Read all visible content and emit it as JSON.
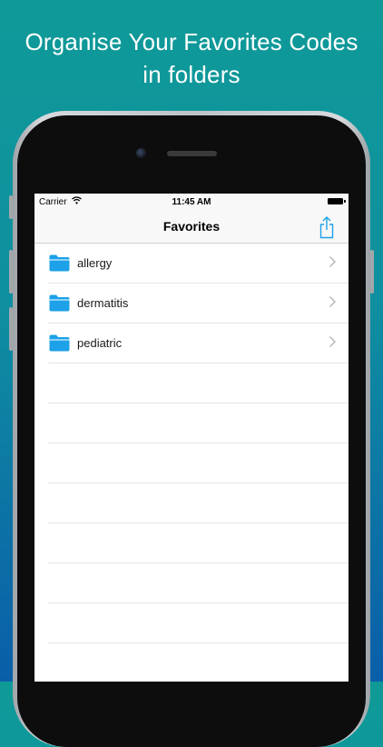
{
  "headline": {
    "line1": "Organise Your Favorites Codes",
    "line2": "in folders"
  },
  "statusbar": {
    "carrier": "Carrier",
    "time": "11:45 AM"
  },
  "navbar": {
    "title": "Favorites",
    "share_icon": "share-icon"
  },
  "folders": [
    {
      "label": "allergy",
      "icon": "folder-icon"
    },
    {
      "label": "dermatitis",
      "icon": "folder-icon"
    },
    {
      "label": "pediatric",
      "icon": "folder-icon"
    }
  ],
  "colors": {
    "accent": "#1da1e8",
    "background_top": "#0f9a98",
    "background_bottom": "#0a5ea9"
  }
}
